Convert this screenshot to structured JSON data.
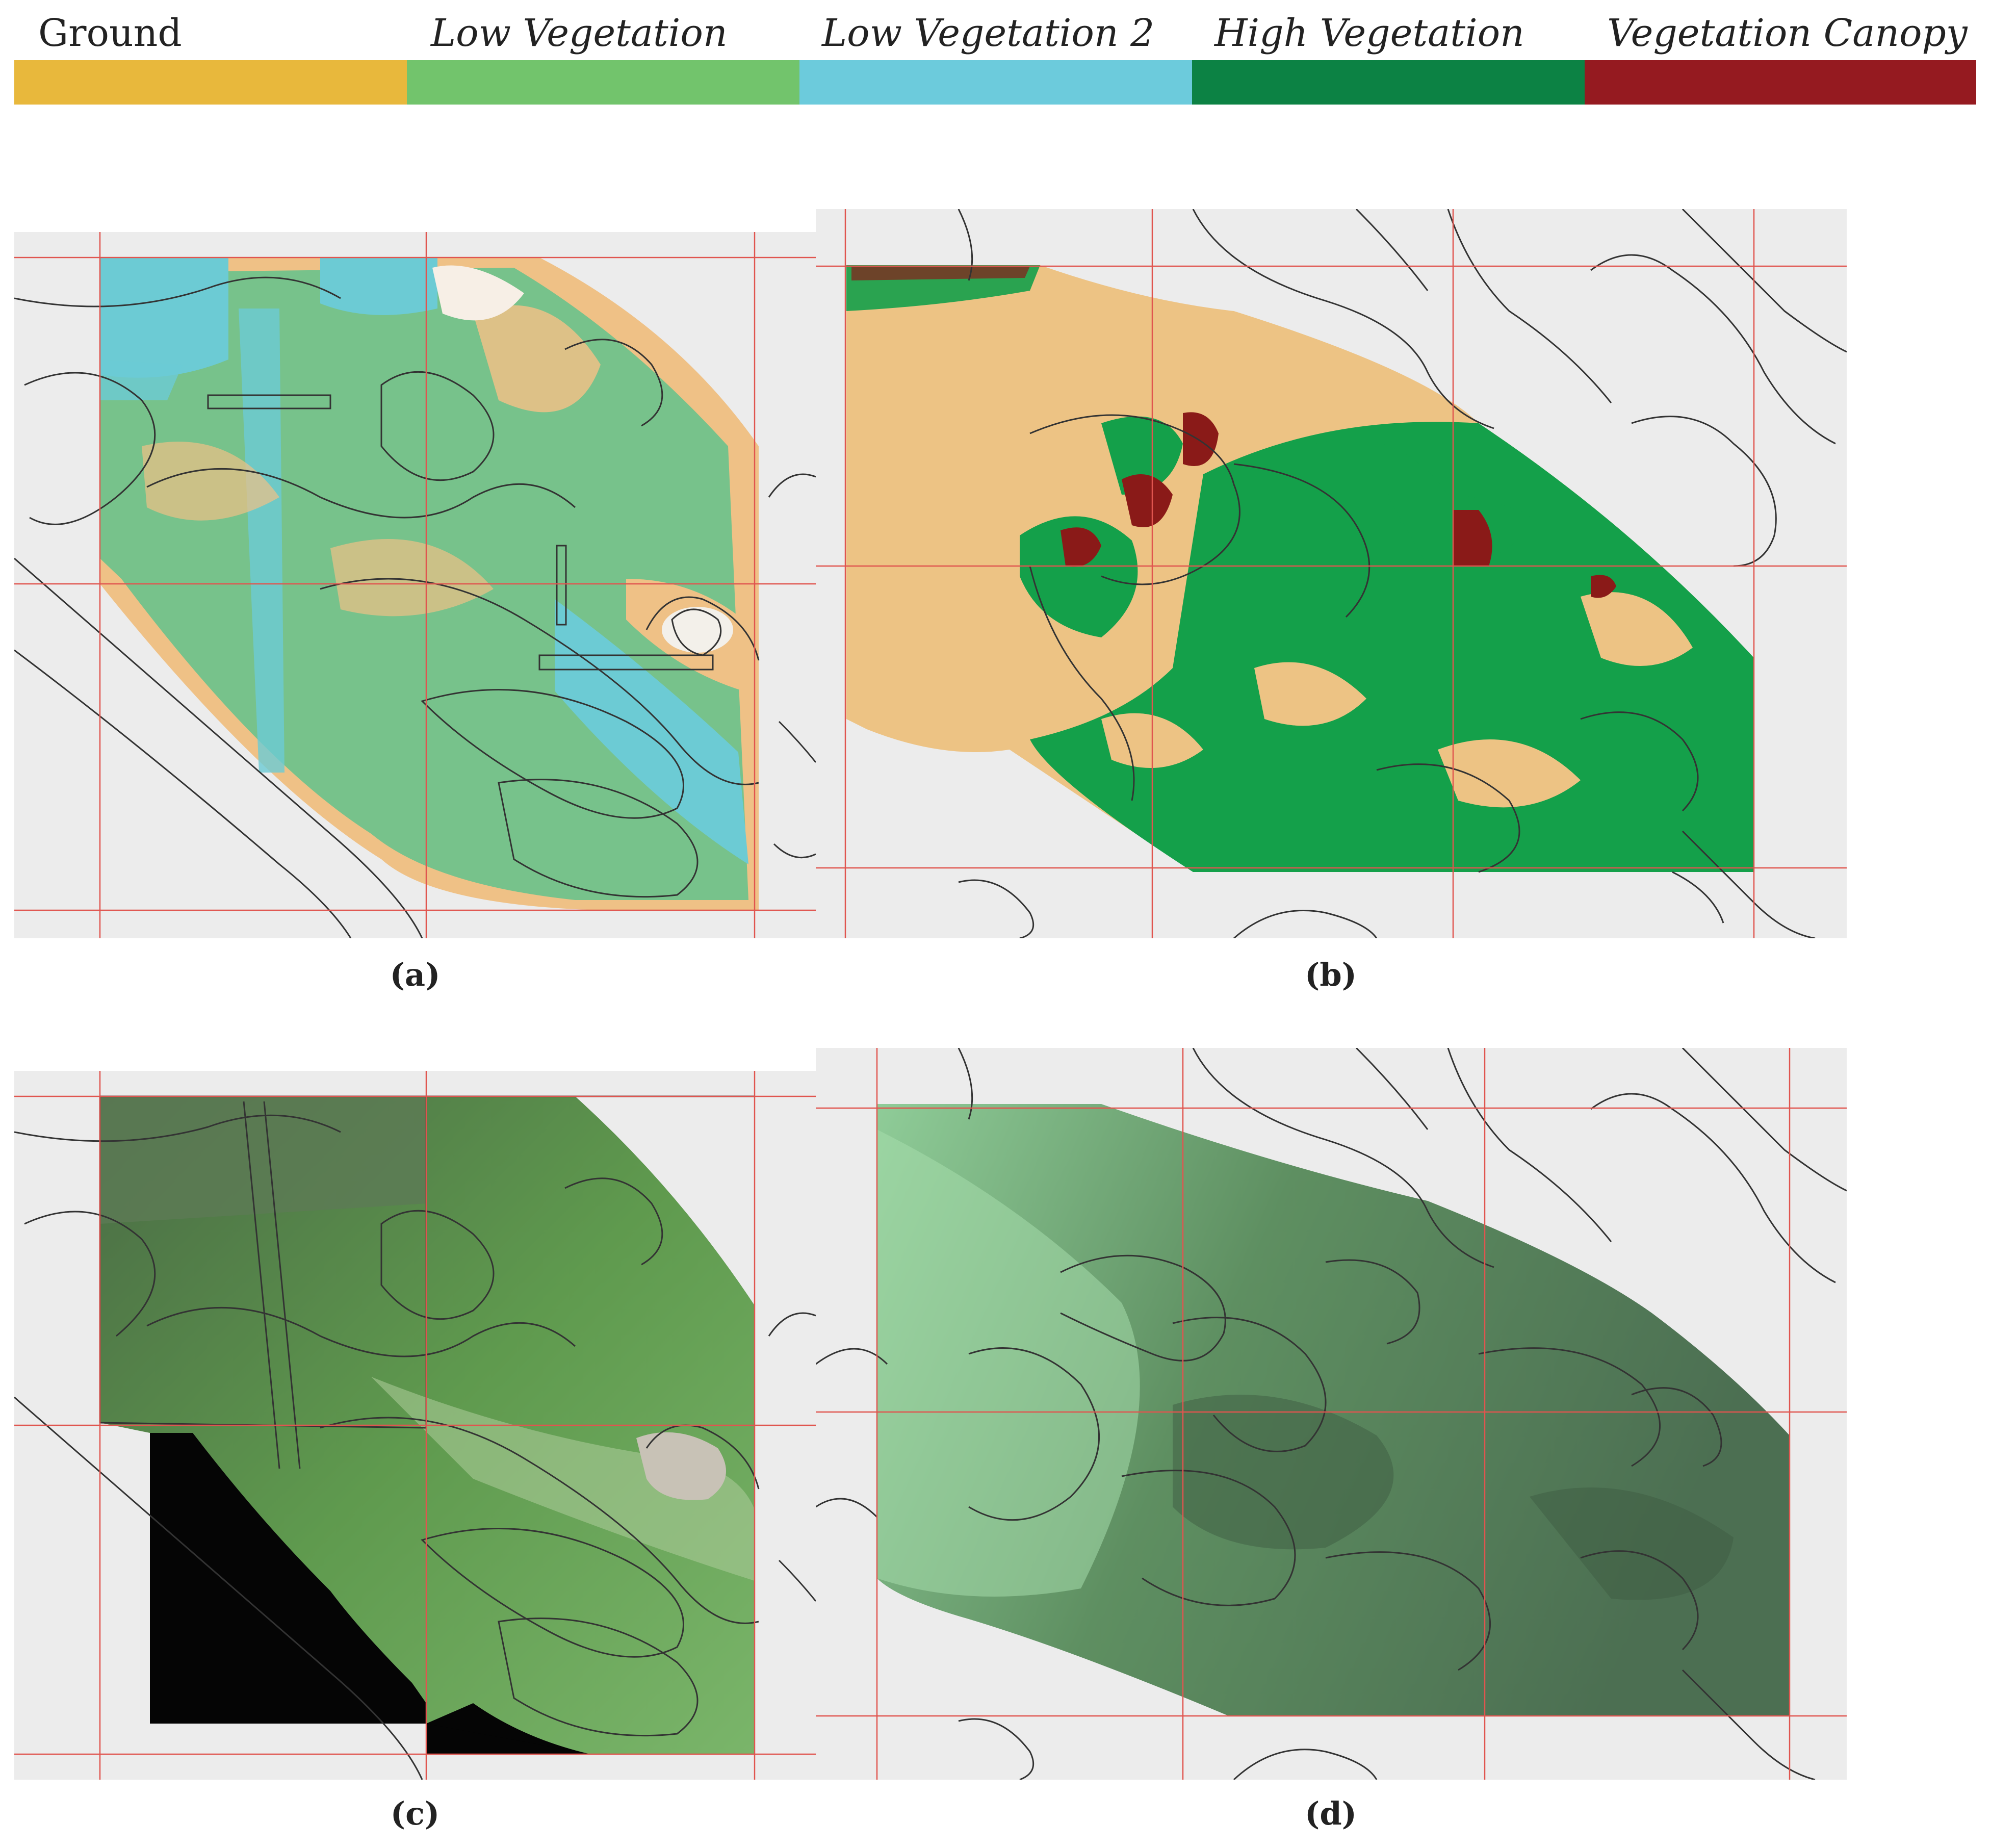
{
  "legend": {
    "items": [
      {
        "label": "Ground",
        "color": "#e8b83c",
        "style": "normal"
      },
      {
        "label": "Low Vegetation",
        "color": "#72c46c",
        "style": "italic"
      },
      {
        "label": "Low Vegetation 2",
        "color": "#6ccbdc",
        "style": "italic"
      },
      {
        "label": "High Vegetation",
        "color": "#0c8244",
        "style": "italic"
      },
      {
        "label": "Vegetation Canopy",
        "color": "#951a20",
        "style": "italic"
      }
    ]
  },
  "panels": {
    "a": {
      "caption": "(a)"
    },
    "b": {
      "caption": "(b)"
    },
    "c": {
      "caption": "(c)"
    },
    "d": {
      "caption": "(d)"
    }
  },
  "colors": {
    "background": "#ececec",
    "grid_line": "#e0554f",
    "contour_line": "#333333",
    "ground_class_a": "#efc186",
    "low_veg_class_a": "#6cc28c",
    "low_veg2_class_a": "#6ccbd4",
    "ground_class_b": "#edc384",
    "high_veg_class_b": "#14a04a",
    "canopy_class_b": "#8a1a18",
    "imagery_dark": "#3f6b3f",
    "imagery_light": "#8cc98e"
  }
}
